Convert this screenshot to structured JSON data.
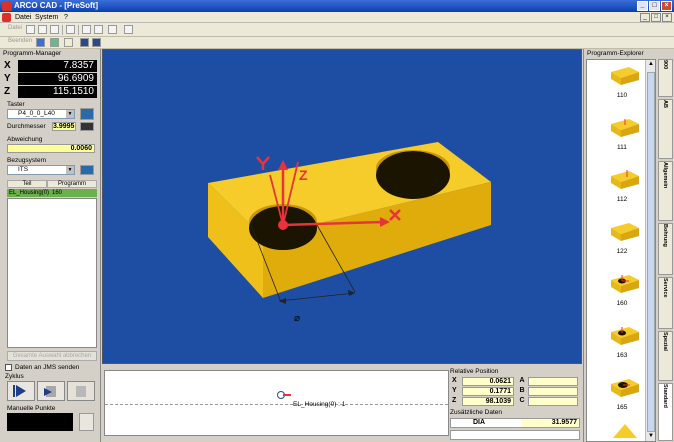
{
  "window": {
    "title": "ARCO CAD - [PreSoft]"
  },
  "menu": {
    "items": [
      "Datei",
      "System",
      "?"
    ]
  },
  "toolbar1": {
    "label": "Datei"
  },
  "toolbar2": {
    "label": "Beenden"
  },
  "program_manager": {
    "title": "Programm-Manager",
    "coords": [
      {
        "axis": "X",
        "value": "7.8357"
      },
      {
        "axis": "Y",
        "value": "96.6909"
      },
      {
        "axis": "Z",
        "value": "115.1510"
      }
    ],
    "taster_label": "Taster",
    "taster_value": "P4_0_0_L40",
    "durchmesser_label": "Durchmesser",
    "durchmesser_value": "3.9995",
    "abweichung_label": "Abweichung",
    "abweichung_value": "0.0060",
    "bezug_label": "Bezugsystem",
    "bezug_value": "ITS",
    "grid_headers": [
      "Teil",
      "Programm"
    ],
    "grid_row": {
      "teil": "EL_Housing(0)",
      "programm": "160"
    },
    "disabled_button": "Gesamte Auswahl abbrechen",
    "jms_label": "Daten an JMS senden",
    "zyklus_label": "Zyklus",
    "manuelle_label": "Manuelle Punkte"
  },
  "viewport": {
    "axis_z": "Z",
    "diameter_symbol": "⌀",
    "colors": {
      "background": "#1e4ea4",
      "part": "#f2c21a",
      "axis": "#e8333a"
    }
  },
  "trace": {
    "label": "EL_Housing(0) : 1"
  },
  "relative_position": {
    "title": "Relative Position",
    "rows": [
      {
        "axis": "X",
        "value": "0.0621",
        "axis2": "A"
      },
      {
        "axis": "Y",
        "value": "0.1771",
        "axis2": "B"
      },
      {
        "axis": "Z",
        "value": "98.1039",
        "axis2": "C"
      }
    ],
    "extra_title": "Zusätzliche Daten",
    "extra_label": "DIA",
    "extra_value": "31.9577"
  },
  "explorer": {
    "title": "Programm-Explorer",
    "items": [
      "110",
      "111",
      "112",
      "122",
      "160",
      "163",
      "165"
    ],
    "tabs": [
      "900",
      "AB",
      "Allgemein",
      "Bohrung",
      "Service",
      "Spezial",
      "Standard"
    ]
  }
}
